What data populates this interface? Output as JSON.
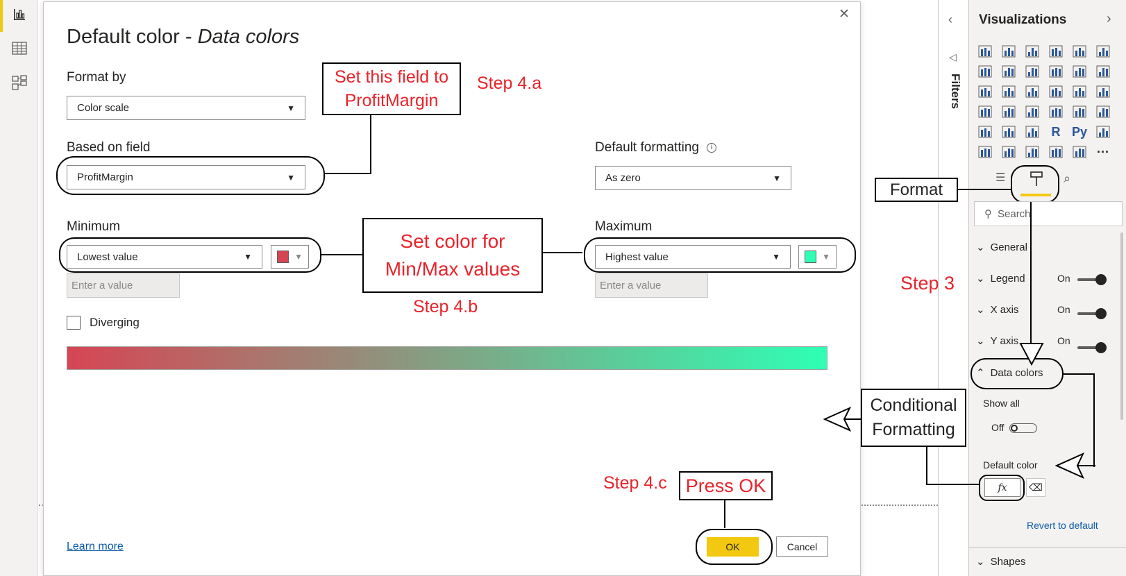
{
  "leftnav": {
    "icons": [
      "report-view-icon",
      "data-view-icon",
      "model-view-icon"
    ]
  },
  "dialog": {
    "title_prefix": "Default color - ",
    "title_italic": "Data colors",
    "close_glyph": "✕",
    "format_by": {
      "label": "Format by",
      "value": "Color scale"
    },
    "based_on_field": {
      "label": "Based on field",
      "value": "ProfitMargin"
    },
    "default_formatting": {
      "label": "Default formatting",
      "value": "As zero"
    },
    "minimum": {
      "label": "Minimum",
      "value": "Lowest value",
      "placeholder": "Enter a value",
      "color": "#d64554"
    },
    "maximum": {
      "label": "Maximum",
      "value": "Highest value",
      "placeholder": "Enter a value",
      "color": "#2effb4"
    },
    "diverging": {
      "label": "Diverging",
      "checked": false
    },
    "gradient": {
      "from": "#d64554",
      "to": "#2effb4"
    },
    "learn_more": "Learn more",
    "ok": "OK",
    "cancel": "Cancel"
  },
  "annotations": {
    "set_field_line1": "Set this field to",
    "set_field_line2": "ProfitMargin",
    "step_4a": "Step 4.a",
    "set_color_line1": "Set color for",
    "set_color_line2": "Min/Max values",
    "step_4b": "Step 4.b",
    "step_4c": "Step 4.c",
    "press_ok": "Press OK",
    "format": "Format",
    "step_3": "Step 3",
    "cond_line1": "Conditional",
    "cond_line2": "Formatting"
  },
  "filters": {
    "label": "Filters"
  },
  "viz": {
    "title": "Visualizations",
    "search_placeholder": "Search",
    "sections": {
      "general": "General",
      "legend": "Legend",
      "xaxis": "X axis",
      "yaxis": "Y axis",
      "data_colors": "Data colors",
      "shapes": "Shapes"
    },
    "on": "On",
    "show_all": "Show all",
    "off": "Off",
    "default_color": "Default color",
    "fx": "fx",
    "revert": "Revert to default",
    "r_label": "R",
    "py_label": "Py",
    "more": "···"
  }
}
